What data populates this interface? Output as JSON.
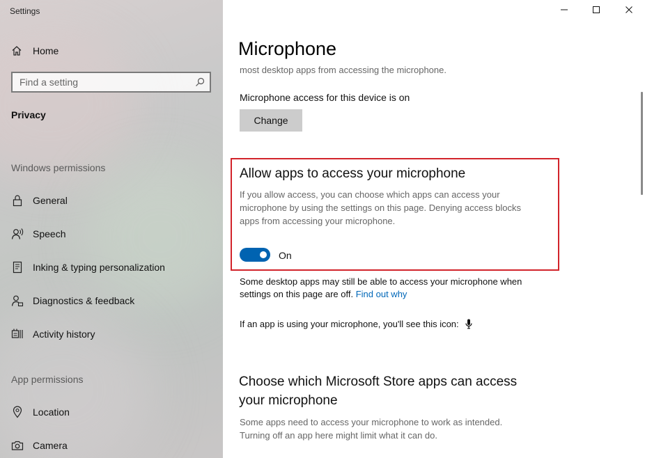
{
  "window": {
    "title": "Settings",
    "controls": {
      "minimize": "minimize-icon",
      "maximize": "maximize-icon",
      "close": "close-icon"
    }
  },
  "sidebar": {
    "home_label": "Home",
    "search_placeholder": "Find a setting",
    "section_title": "Privacy",
    "windows_permissions_header": "Windows permissions",
    "windows_permissions": [
      {
        "label": "General",
        "icon": "lock-icon"
      },
      {
        "label": "Speech",
        "icon": "speech-icon"
      },
      {
        "label": "Inking & typing personalization",
        "icon": "inking-icon"
      },
      {
        "label": "Diagnostics & feedback",
        "icon": "diagnostics-icon"
      },
      {
        "label": "Activity history",
        "icon": "activity-history-icon"
      }
    ],
    "app_permissions_header": "App permissions",
    "app_permissions": [
      {
        "label": "Location",
        "icon": "location-icon"
      },
      {
        "label": "Camera",
        "icon": "camera-icon"
      }
    ]
  },
  "main": {
    "title": "Microphone",
    "intro_tail": "most desktop apps from accessing the microphone.",
    "device_access_status": "Microphone access for this device is on",
    "change_button": "Change",
    "allow_apps": {
      "heading": "Allow apps to access your microphone",
      "description_lines": [
        "If you allow access, you can choose which apps can access your",
        "microphone by using the settings on this page. Denying access blocks",
        "apps from accessing your microphone."
      ],
      "toggle_state": "On",
      "toggle_on": true
    },
    "desktop_note_line1": "Some desktop apps may still be able to access your microphone when",
    "desktop_note_line2": "settings on this page are off.",
    "find_out_why": "Find out why",
    "icon_note": "If an app is using your microphone, you'll see this icon:",
    "store_heading_line1": "Choose which Microsoft Store apps can access",
    "store_heading_line2": "your microphone",
    "store_desc_line1": "Some apps need to access your microphone to work as intended.",
    "store_desc_line2": "Turning off an app here might limit what it can do."
  },
  "colors": {
    "accent": "#0063b1",
    "link": "#0067b8",
    "highlight_border": "#d2232a"
  }
}
